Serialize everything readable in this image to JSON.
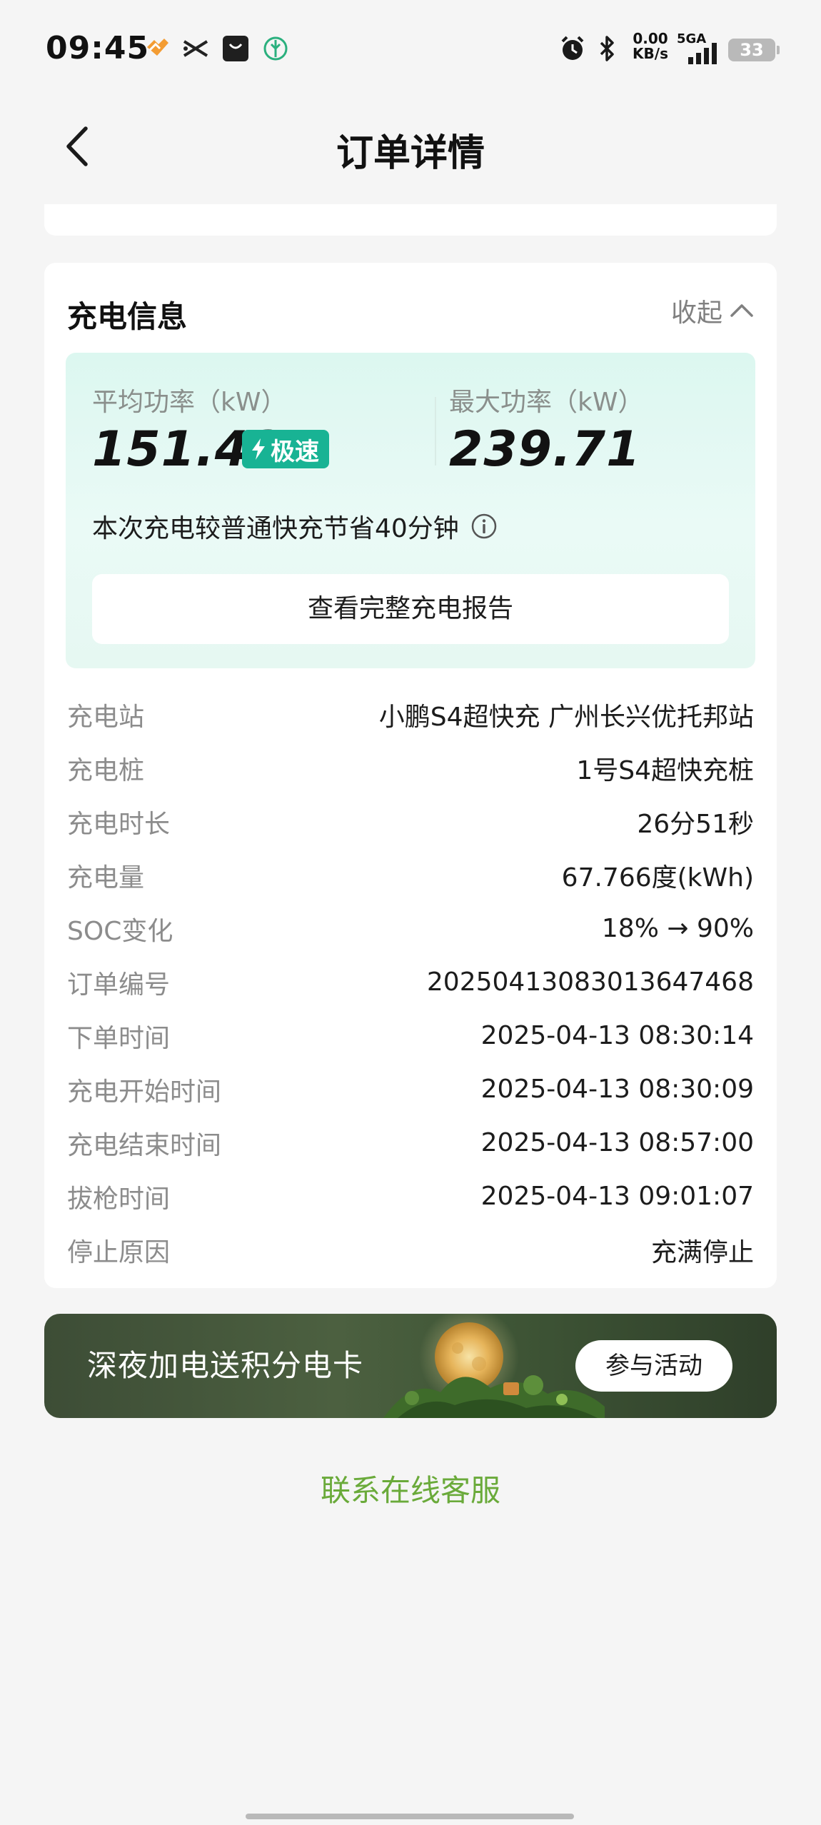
{
  "status_bar": {
    "time": "09:45",
    "net_speed": "0.00\nKB/s",
    "signal_label": "5GA",
    "battery": "33",
    "icons": [
      "app-logo-icon",
      "scissors-icon",
      "shopping-bag-icon",
      "charging-app-icon",
      "alarm-icon",
      "bluetooth-icon",
      "signal-icon",
      "battery-icon"
    ]
  },
  "header": {
    "title": "订单详情",
    "back_icon": "chevron-left-icon"
  },
  "charging_info": {
    "title": "充电信息",
    "collapse_label": "收起",
    "avg_power_label": "平均功率（kW）",
    "avg_power_value": "151.43",
    "speed_badge": "极速",
    "max_power_label": "最大功率（kW）",
    "max_power_value": "239.71",
    "saving_note": "本次充电较普通快充节省40分钟",
    "report_button": "查看完整充电报告",
    "details": [
      {
        "label": "充电站",
        "value": "小鹏S4超快充 广州长兴优托邦站"
      },
      {
        "label": "充电桩",
        "value": "1号S4超快充桩"
      },
      {
        "label": "充电时长",
        "value": "26分51秒"
      },
      {
        "label": "充电量",
        "value": "67.766度(kWh)"
      },
      {
        "label": "SOC变化",
        "value": "18% → 90%"
      },
      {
        "label": "订单编号",
        "value": "20250413083013647468"
      },
      {
        "label": "下单时间",
        "value": "2025-04-13 08:30:14"
      },
      {
        "label": "充电开始时间",
        "value": "2025-04-13 08:30:09"
      },
      {
        "label": "充电结束时间",
        "value": "2025-04-13 08:57:00"
      },
      {
        "label": "拔枪时间",
        "value": "2025-04-13 09:01:07"
      },
      {
        "label": "停止原因",
        "value": "充满停止"
      }
    ]
  },
  "promo": {
    "text": "深夜加电送积分电卡",
    "button": "参与活动"
  },
  "service_link": "联系在线客服",
  "colors": {
    "accent_teal": "#18b394",
    "link_green": "#6aaa3a",
    "panel_bg": "#dcf7f0",
    "page_bg": "#f5f5f5"
  }
}
